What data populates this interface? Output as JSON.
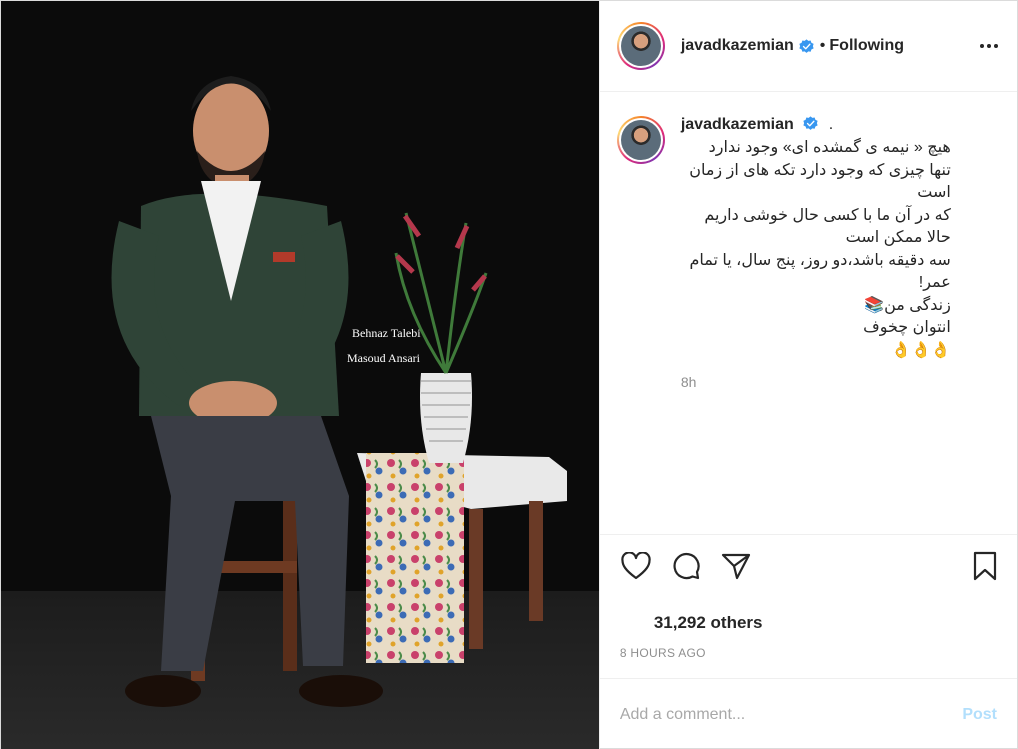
{
  "post": {
    "author": "javadkazemian",
    "follow_status": "Following",
    "separator": "•",
    "more_icon": "more-horizontal-icon",
    "verified_icon": "verified-badge-icon",
    "photo_credits": [
      "Behnaz Talebi",
      "Masoud Ansari"
    ]
  },
  "caption": {
    "author": "javadkazemian",
    "trailing": ".",
    "text": "هیچ « نیمه ی گمشده ای» وجود ندارد\nتنها چیزی که وجود دارد تکه های از زمان است\nکه در آن ما با کسی حال خوشی داریم\nحالا ممکن است\nسه دقیقه باشد،دو روز، پنج سال، یا تمام عمر!\nزندگی من📚\nانتوان چخوف\n👌👌👌",
    "time_ago": "8h"
  },
  "actions": {
    "like_icon": "heart-icon",
    "comment_icon": "comment-icon",
    "share_icon": "share-icon",
    "save_icon": "bookmark-icon"
  },
  "likes": {
    "text": "31,292 others"
  },
  "timestamp": "8 HOURS AGO",
  "comment": {
    "placeholder": "Add a comment...",
    "post_label": "Post"
  },
  "colors": {
    "verified": "#3897f0",
    "post_disabled": "#b2dffc",
    "muted": "#8e8e8e"
  }
}
